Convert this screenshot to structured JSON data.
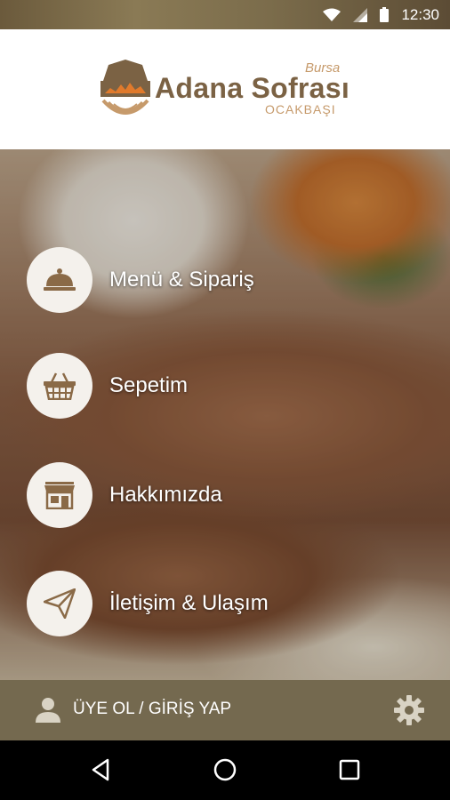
{
  "status_bar": {
    "time": "12:30",
    "icons": [
      "wifi-icon",
      "signal-icon",
      "battery-icon"
    ]
  },
  "header": {
    "logo": {
      "top_word": "Bursa",
      "title": "Adana Sofrası",
      "bottom_word": "OCAKBAŞI"
    }
  },
  "menu": {
    "items": [
      {
        "label": "Menü & Sipariş",
        "icon": "serving-cloche-icon"
      },
      {
        "label": "Sepetim",
        "icon": "basket-icon"
      },
      {
        "label": "Hakkımızda",
        "icon": "storefront-icon"
      },
      {
        "label": "İletişim & Ulaşım",
        "icon": "paper-plane-icon"
      }
    ]
  },
  "footer": {
    "login_label": "ÜYE OL / GİRİŞ YAP",
    "user_icon": "user-icon",
    "settings_icon": "gear-icon"
  },
  "navbar": {
    "icons": [
      "back-icon",
      "home-icon",
      "recents-icon"
    ]
  },
  "colors": {
    "brand_brown": "#7b6244",
    "brand_tan": "#c69a6b",
    "footer_bg": "#74694f",
    "icon_brown": "#8a6a47"
  }
}
